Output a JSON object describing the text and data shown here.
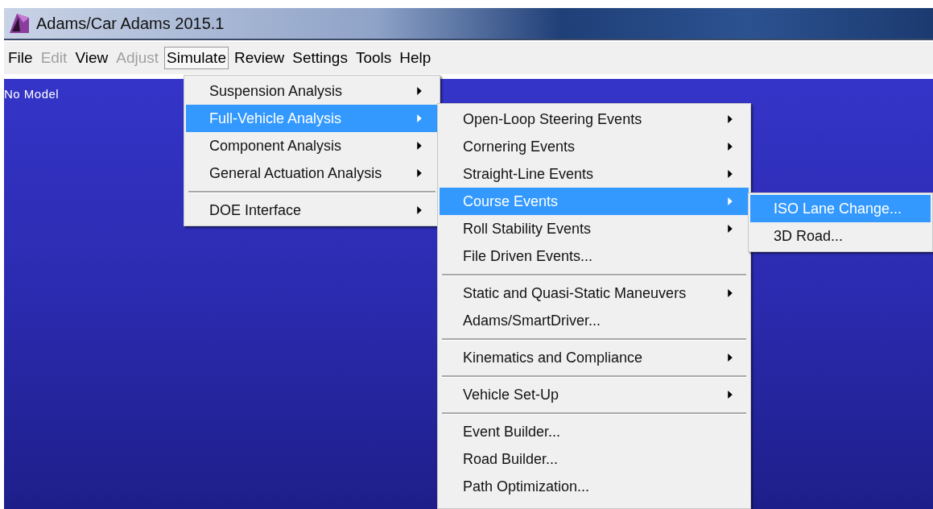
{
  "window": {
    "title": "Adams/Car Adams 2015.1"
  },
  "menubar": [
    {
      "label": "File",
      "disabled": false,
      "selected": false
    },
    {
      "label": "Edit",
      "disabled": true,
      "selected": false
    },
    {
      "label": "View",
      "disabled": false,
      "selected": false
    },
    {
      "label": "Adjust",
      "disabled": true,
      "selected": false
    },
    {
      "label": "Simulate",
      "disabled": false,
      "selected": true
    },
    {
      "label": "Review",
      "disabled": false,
      "selected": false
    },
    {
      "label": "Settings",
      "disabled": false,
      "selected": false
    },
    {
      "label": "Tools",
      "disabled": false,
      "selected": false
    },
    {
      "label": "Help",
      "disabled": false,
      "selected": false
    }
  ],
  "canvas": {
    "label": "No Model"
  },
  "menus": [
    {
      "items": [
        {
          "kind": "item",
          "label": "Suspension Analysis",
          "submenu": true,
          "selected": false
        },
        {
          "kind": "item",
          "label": "Full-Vehicle Analysis",
          "submenu": true,
          "selected": true
        },
        {
          "kind": "item",
          "label": "Component Analysis",
          "submenu": true,
          "selected": false
        },
        {
          "kind": "item",
          "label": "General Actuation Analysis",
          "submenu": true,
          "selected": false
        },
        {
          "kind": "separator"
        },
        {
          "kind": "item",
          "label": "DOE Interface",
          "submenu": true,
          "selected": false
        }
      ]
    },
    {
      "items": [
        {
          "kind": "item",
          "label": "Open-Loop Steering Events",
          "submenu": true,
          "selected": false
        },
        {
          "kind": "item",
          "label": "Cornering Events",
          "submenu": true,
          "selected": false
        },
        {
          "kind": "item",
          "label": "Straight-Line Events",
          "submenu": true,
          "selected": false
        },
        {
          "kind": "item",
          "label": "Course Events",
          "submenu": true,
          "selected": true
        },
        {
          "kind": "item",
          "label": "Roll Stability Events",
          "submenu": true,
          "selected": false
        },
        {
          "kind": "item",
          "label": "File Driven Events...",
          "submenu": false,
          "selected": false
        },
        {
          "kind": "separator"
        },
        {
          "kind": "item",
          "label": "Static and Quasi-Static Maneuvers",
          "submenu": true,
          "selected": false
        },
        {
          "kind": "item",
          "label": "Adams/SmartDriver...",
          "submenu": false,
          "selected": false
        },
        {
          "kind": "separator"
        },
        {
          "kind": "item",
          "label": "Kinematics and Compliance",
          "submenu": true,
          "selected": false
        },
        {
          "kind": "separator"
        },
        {
          "kind": "item",
          "label": "Vehicle Set-Up",
          "submenu": true,
          "selected": false
        },
        {
          "kind": "separator"
        },
        {
          "kind": "item",
          "label": "Event Builder...",
          "submenu": false,
          "selected": false
        },
        {
          "kind": "item",
          "label": "Road Builder...",
          "submenu": false,
          "selected": false
        },
        {
          "kind": "item",
          "label": "Path Optimization...",
          "submenu": false,
          "selected": false
        }
      ]
    },
    {
      "items": [
        {
          "kind": "item",
          "label": "ISO Lane Change...",
          "submenu": false,
          "selected": true
        },
        {
          "kind": "item",
          "label": "3D Road...",
          "submenu": false,
          "selected": false
        }
      ]
    }
  ]
}
